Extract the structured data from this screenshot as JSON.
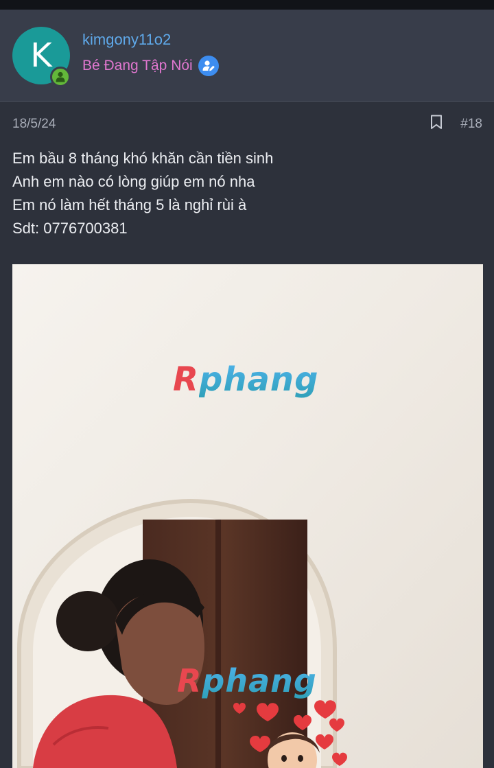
{
  "user": {
    "avatar_letter": "K",
    "username": "kimgony11o2",
    "title": "Bé Đang Tập Nói"
  },
  "post": {
    "date": "18/5/24",
    "number": "#18",
    "lines": [
      "Em bầu 8 tháng khó khăn cần tiền sinh",
      "Anh em nào có lòng giúp em nó nha",
      "Em nó làm hết tháng 5 là nghỉ rùi à",
      "Sdt: 0776700381"
    ]
  },
  "attachment": {
    "watermark_first": "R",
    "watermark_rest": "phang"
  },
  "colors": {
    "background": "#2d313b",
    "header": "#383d4a",
    "username": "#5fa9ea",
    "user_title": "#e077cf",
    "avatar": "#1a9a98",
    "online": "#63b83a",
    "verified": "#3d8df0"
  }
}
